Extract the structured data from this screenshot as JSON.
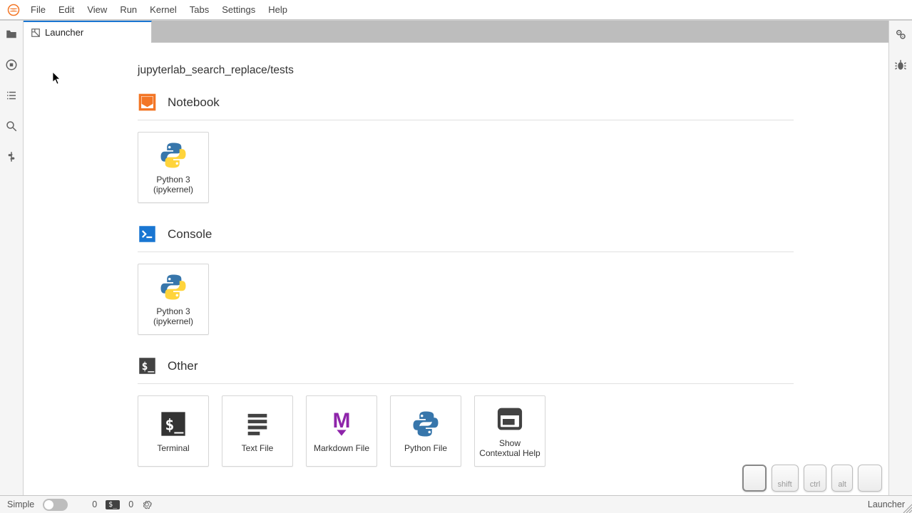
{
  "menu": {
    "items": [
      "File",
      "Edit",
      "View",
      "Run",
      "Kernel",
      "Tabs",
      "Settings",
      "Help"
    ]
  },
  "activity": {
    "items": [
      "folder",
      "running",
      "toc",
      "search",
      "extensions"
    ]
  },
  "rightbar": {
    "items": [
      "properties",
      "debugger"
    ]
  },
  "tabs": {
    "items": [
      {
        "label": "Launcher"
      }
    ]
  },
  "launcher": {
    "breadcrumb": "jupyterlab_search_replace/tests",
    "sections": [
      {
        "title": "Notebook",
        "icon": "notebook",
        "cards": [
          {
            "label": "Python 3 (ipykernel)",
            "icon": "python"
          }
        ]
      },
      {
        "title": "Console",
        "icon": "console",
        "cards": [
          {
            "label": "Python 3 (ipykernel)",
            "icon": "python"
          }
        ]
      },
      {
        "title": "Other",
        "icon": "terminal",
        "cards": [
          {
            "label": "Terminal",
            "icon": "terminal"
          },
          {
            "label": "Text File",
            "icon": "textfile"
          },
          {
            "label": "Markdown File",
            "icon": "markdown"
          },
          {
            "label": "Python File",
            "icon": "python"
          },
          {
            "label": "Show Contextual Help",
            "icon": "help"
          }
        ]
      }
    ]
  },
  "statusbar": {
    "simple_label": "Simple",
    "tabs_count": "0",
    "terms_count": "0",
    "right_label": "Launcher"
  },
  "keys": [
    "",
    "shift",
    "ctrl",
    "alt",
    ""
  ]
}
